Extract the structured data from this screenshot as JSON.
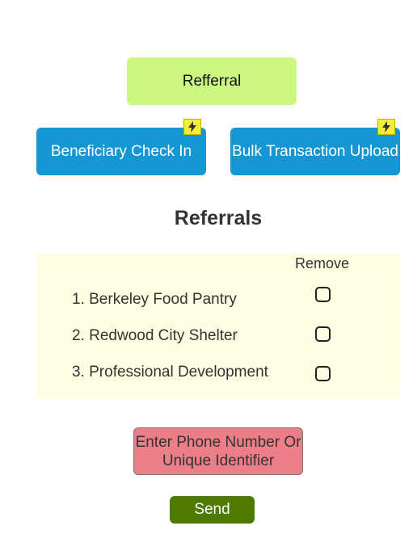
{
  "top": {
    "referral_button": "Refferral",
    "checkin_button": "Beneficiary Check In",
    "bulk_upload_button": "Bulk Transaction Upload"
  },
  "section": {
    "title": "Referrals",
    "remove_header": "Remove",
    "items": [
      {
        "label": "1. Berkeley Food Pantry"
      },
      {
        "label": "2. Redwood City Shelter"
      },
      {
        "label": "3. Professional Development"
      }
    ]
  },
  "input": {
    "placeholder": "Enter Phone Number Or Unique Identifier"
  },
  "actions": {
    "send_label": "Send"
  },
  "colors": {
    "referral_bg": "#ccf780",
    "primary_blue": "#1597d4",
    "bolt_yellow": "#f2ee3a",
    "panel_bg": "#fefee2",
    "input_bg": "#ec7e87",
    "send_bg": "#4e7a00"
  },
  "icons": {
    "lightning": "lightning-icon"
  }
}
